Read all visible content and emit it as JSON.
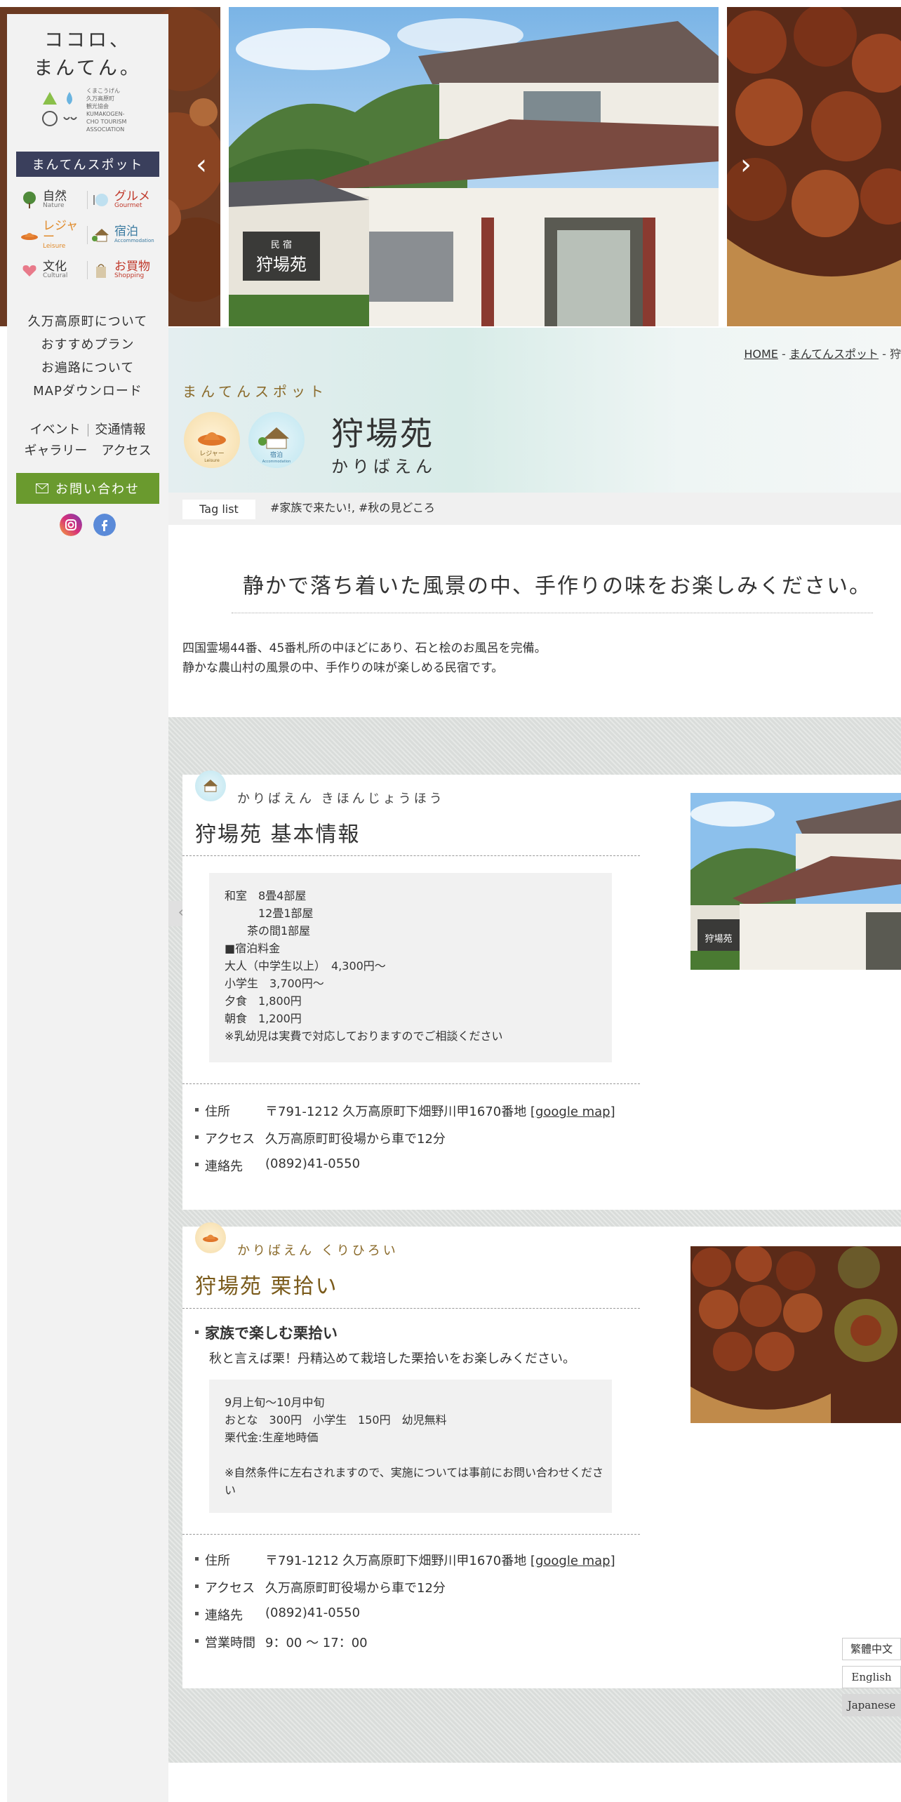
{
  "sidebar": {
    "logo_line1": "ココロ、",
    "logo_line2": "まんてん。",
    "logo_org_line1": "くまこうげん",
    "logo_org_line2": "久万高原町",
    "logo_org_line3": "観光協会",
    "logo_org_line4": "KUMAKOGEN-CHO TOURISM ASSOCIATION",
    "spot_header": "まんてんスポット",
    "categories": [
      {
        "jp": "自然",
        "en": "Nature",
        "color": "#5a8a3a",
        "icon": "tree-icon"
      },
      {
        "jp": "グルメ",
        "en": "Gourmet",
        "color": "#c0392b",
        "icon": "plate-icon"
      },
      {
        "jp": "レジャー",
        "en": "Leisure",
        "color": "#e08a2a",
        "icon": "hat-icon"
      },
      {
        "jp": "宿泊",
        "en": "Accommodation",
        "color": "#3a7aa0",
        "icon": "house-icon"
      },
      {
        "jp": "文化",
        "en": "Cultural",
        "color": "#555555",
        "icon": "heart-icon"
      },
      {
        "jp": "お買物",
        "en": "Shopping",
        "color": "#c0392b",
        "icon": "bag-icon"
      }
    ],
    "links": [
      "久万高原町について",
      "おすすめプラン",
      "お遍路について",
      "MAPダウンロード"
    ],
    "row1": [
      "イベント",
      "交通情報"
    ],
    "row2": [
      "ギャラリー",
      "アクセス"
    ],
    "contact": "お問い合わせ"
  },
  "breadcrumb": {
    "home": "HOME",
    "sep": " - ",
    "spot": "まんてんスポット",
    "tail": " - 狩"
  },
  "title": {
    "spot_label": "まんてんスポット",
    "badge1_label": "レジャー",
    "badge1_en": "Leisure",
    "badge2_label": "宿泊",
    "badge2_en": "Accommodation",
    "name": "狩場苑",
    "kana": "かりばえん"
  },
  "tags": {
    "label": "Tag list",
    "text": "#家族で来たい!, #秋の見どころ"
  },
  "intro": {
    "heading": "静かで落ち着いた風景の中、手作りの味をお楽しみください。",
    "line1": "四国霊場44番、45番札所の中ほどにあり、石と桧のお風呂を完備。",
    "line2": "静かな農山村の風景の中、手作りの味が楽しめる民宿です。"
  },
  "card1": {
    "icon_label": "宿泊",
    "kana": "かりばえん きほんじょうほう",
    "title": "狩場苑 基本情報",
    "info": [
      "和室　8畳4部屋",
      "　　　12畳1部屋",
      "　　茶の間1部屋",
      "■宿泊料金",
      "大人（中学生以上）　4,300円～",
      "小学生　3,700円～",
      "夕食　1,800円",
      "朝食　1,200円",
      "※乳幼児は実費で対応しておりますのでご相談ください"
    ],
    "address_key": "住所",
    "address": "〒791-1212 久万高原町下畑野川甲1670番地 ",
    "map_link": "[google map]",
    "access_key": "アクセス",
    "access": "久万高原町町役場から車で12分",
    "contact_key": "連絡先",
    "contact": "(0892)41-0550"
  },
  "card2": {
    "icon_label": "レジャー",
    "kana": "かりばえん くりひろい",
    "title": "狩場苑 栗拾い",
    "sub_heading": "家族で楽しむ栗拾い",
    "sub_desc": "秋と言えば栗！丹精込めて栽培した栗拾いをお楽しみください。",
    "info": [
      "9月上旬～10月中旬",
      "おとな　300円　小学生　150円　幼児無料",
      "栗代金:生産地時価",
      "",
      "※自然条件に左右されますので、実施については事前にお問い合わせくださ",
      "い"
    ],
    "address_key": "住所",
    "address": "〒791-1212 久万高原町下畑野川甲1670番地 ",
    "map_link": "[google map]",
    "access_key": "アクセス",
    "access": "久万高原町町役場から車で12分",
    "contact_key": "連絡先",
    "contact": "(0892)41-0550",
    "hours_key": "営業時間",
    "hours": "9：00 ～ 17：00"
  },
  "nav": {
    "prev": "‹",
    "next": "›",
    "small_prev": "‹"
  },
  "languages": [
    "繁體中文",
    "English",
    "Japanese"
  ],
  "colors": {
    "sidebar_header": "#3a3f5c",
    "contact_button": "#6a9a2e",
    "accent_gold": "#8a6a2a"
  }
}
